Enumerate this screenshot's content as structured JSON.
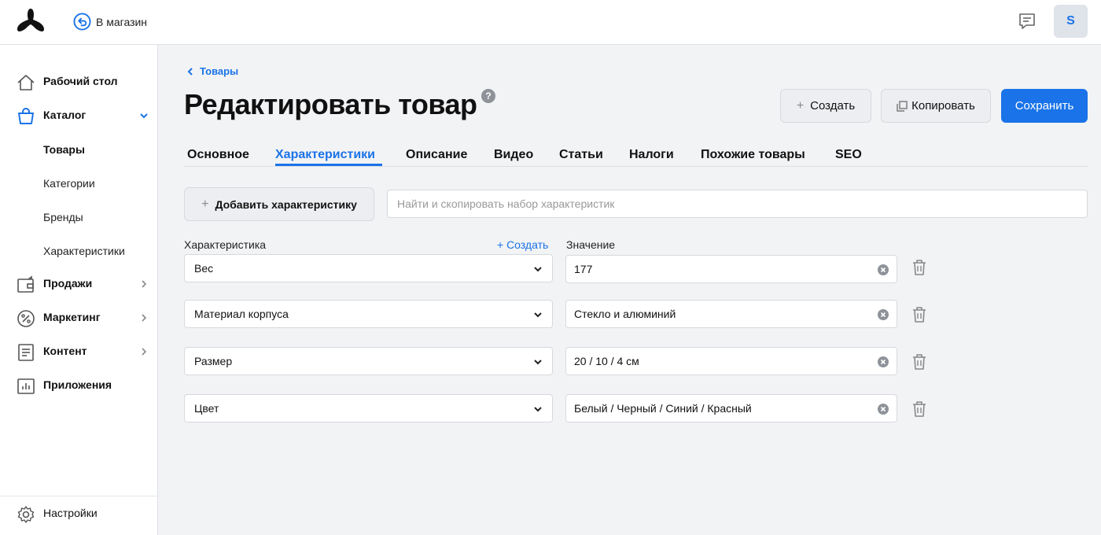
{
  "header": {
    "back_to_store": "В магазин",
    "avatar_letter": "S"
  },
  "sidebar": {
    "items": [
      {
        "label": "Рабочий стол",
        "icon": "home-icon"
      },
      {
        "label": "Каталог",
        "icon": "shopping-bag-icon",
        "expanded": true
      },
      {
        "label": "Продажи",
        "icon": "wallet-icon"
      },
      {
        "label": "Маркетинг",
        "icon": "percent-icon"
      },
      {
        "label": "Контент",
        "icon": "document-icon"
      },
      {
        "label": "Приложения",
        "icon": "chart-icon"
      }
    ],
    "catalog_sub": [
      "Товары",
      "Категории",
      "Бренды",
      "Характеристики"
    ],
    "settings_label": "Настройки"
  },
  "breadcrumb": "Товары",
  "page_title": "Редактировать товар",
  "help_mark": "?",
  "actions": {
    "create": "Создать",
    "copy": "Копировать",
    "save": "Сохранить"
  },
  "tabs": [
    "Основное",
    "Характеристики",
    "Описание",
    "Видео",
    "Статьи",
    "Налоги",
    "Похожие товары",
    "SEO"
  ],
  "add_characteristic": "Добавить характеристику",
  "search_placeholder": "Найти и скопировать набор характеристик",
  "columns": {
    "characteristic": "Характеристика",
    "create_link": "+ Создать",
    "value": "Значение"
  },
  "rows": [
    {
      "characteristic": "Вес",
      "value": "177"
    },
    {
      "characteristic": "Материал корпуса",
      "value": "Стекло и алюминий"
    },
    {
      "characteristic": "Размер",
      "value": "20 / 10 / 4 см"
    },
    {
      "characteristic": "Цвет",
      "value": "Белый / Черный / Синий / Красный"
    }
  ],
  "colors": {
    "accent": "#1a73e8",
    "background": "#f2f3f5"
  }
}
